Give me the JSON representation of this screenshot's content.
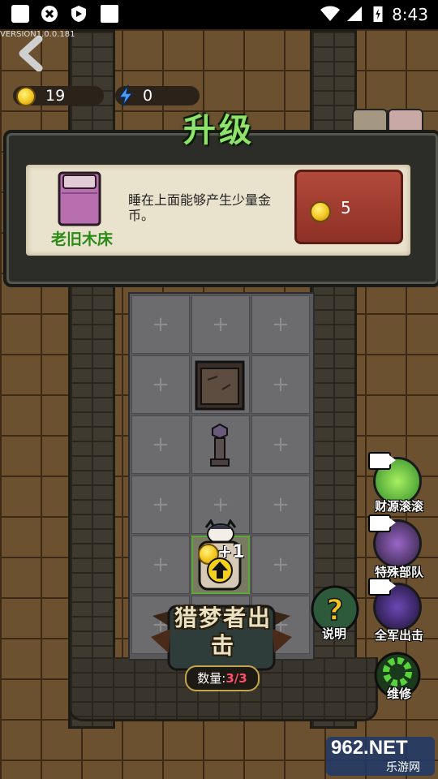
{
  "status_bar": {
    "time": "8:43"
  },
  "version_text": "VERSION1.0.0.181",
  "resources": {
    "coins": "19",
    "energy": "0"
  },
  "upgrade_panel": {
    "title": "升级",
    "item_name": "老旧木床",
    "description": "睡在上面能够产生少量金币。",
    "price": "5"
  },
  "map": {
    "floating_gain": "+1"
  },
  "side_buttons": {
    "wealth": "财源滚滚",
    "special_forces": "特殊部队",
    "all_attack": "全军出击",
    "repair": "维修",
    "help": "说明"
  },
  "sortie": {
    "title": "猎梦者出击",
    "count_label": "数量:",
    "count_value": "3/3"
  },
  "watermark": {
    "brand": "962.NET",
    "sub": "乐游网"
  },
  "colors": {
    "title_green": "#8fe36c",
    "price_button": "#a13c2f",
    "item_name_green": "#2b8a17"
  }
}
